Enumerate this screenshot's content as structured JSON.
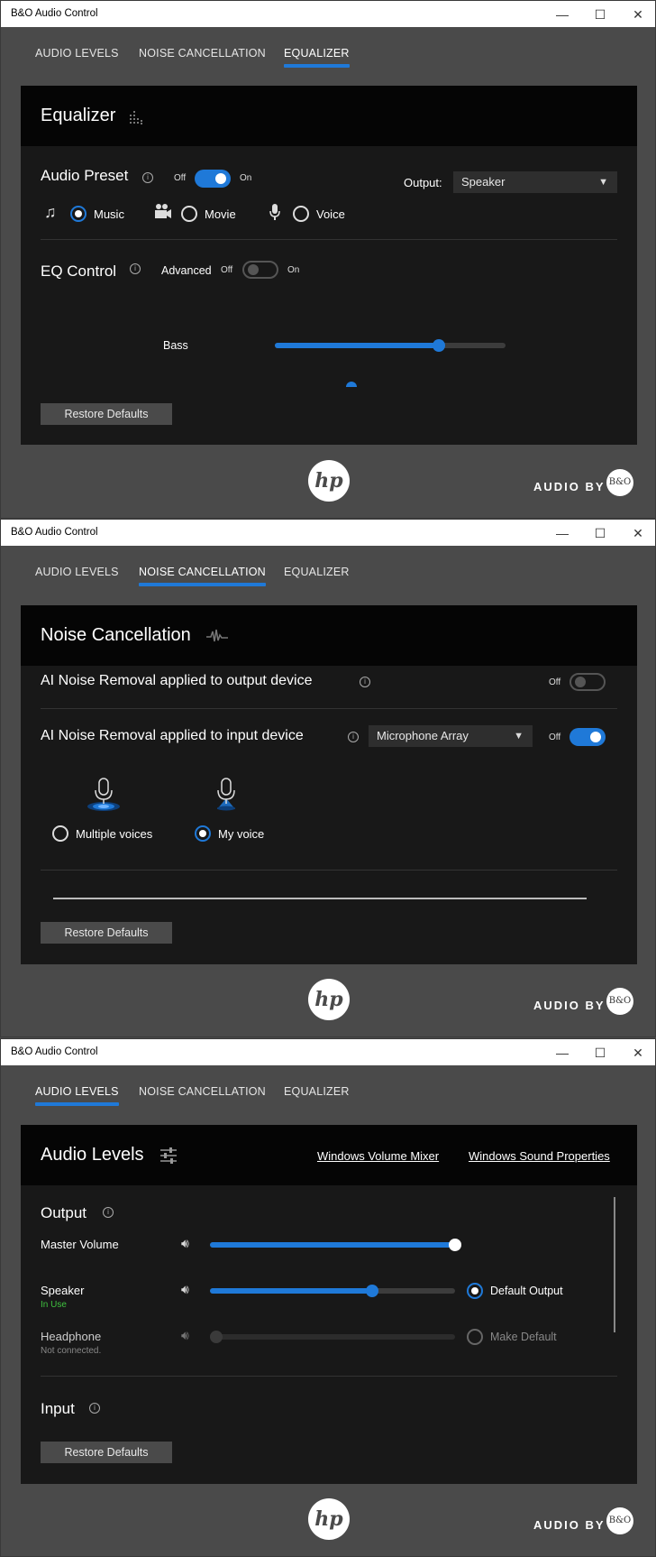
{
  "window_title": "B&O Audio Control",
  "window_controls": {
    "minimize": "—",
    "maximize": "☐",
    "close": "✕"
  },
  "tabs": {
    "audio_levels": "AUDIO LEVELS",
    "noise": "NOISE CANCELLATION",
    "equalizer": "EQUALIZER"
  },
  "restore_defaults": "Restore Defaults",
  "footer": {
    "audio_by": "AUDIO BY",
    "hp": "hp",
    "bo": "B&O"
  },
  "equalizer": {
    "title": "Equalizer",
    "preset_label": "Audio Preset",
    "toggle_off": "Off",
    "toggle_on": "On",
    "preset_enabled": true,
    "output_label": "Output:",
    "output_value": "Speaker",
    "presets": [
      "Music",
      "Movie",
      "Voice"
    ],
    "selected_preset": "Music",
    "eq_label": "EQ Control",
    "advanced_label": "Advanced",
    "advanced_enabled": false,
    "bands": [
      {
        "name": "Bass",
        "value": 0.71
      }
    ]
  },
  "noise": {
    "title": "Noise Cancellation",
    "output_label": "AI Noise Removal applied to output device",
    "output_enabled": false,
    "input_label": "AI Noise Removal applied to input device",
    "input_device": "Microphone Array",
    "input_enabled": true,
    "toggle_off": "Off",
    "modes": [
      "Multiple voices",
      "My voice"
    ],
    "selected_mode": "My voice"
  },
  "levels": {
    "title": "Audio Levels",
    "volume_mixer_link": "Windows Volume Mixer",
    "sound_properties_link": "Windows Sound Properties",
    "output_label": "Output",
    "master_label": "Master Volume",
    "master_value": 1.0,
    "speaker_label": "Speaker",
    "speaker_status": "In Use",
    "speaker_value": 0.66,
    "default_output_label": "Default Output",
    "headphone_label": "Headphone",
    "headphone_status": "Not connected.",
    "headphone_value": 0.0,
    "make_default_label": "Make Default",
    "input_label": "Input"
  },
  "colors": {
    "accent": "#1f79d8",
    "in_use": "#3fc23f",
    "panel": "#181818",
    "header": "#050505",
    "window": "#4a4a4a"
  }
}
